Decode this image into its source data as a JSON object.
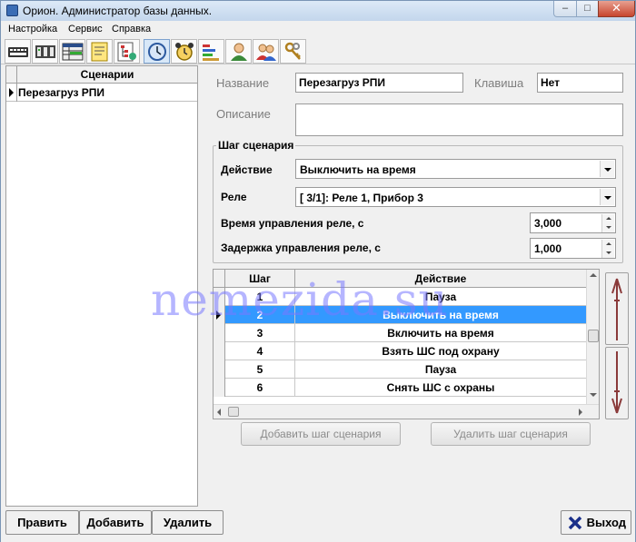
{
  "window": {
    "title": "Орион. Администратор базы данных.",
    "controls": {
      "minimize": "–",
      "maximize": "□",
      "close": "✕"
    }
  },
  "menu": [
    {
      "label": "Настройка"
    },
    {
      "label": "Сервис"
    },
    {
      "label": "Справка"
    }
  ],
  "toolbar": [
    {
      "icon": "keyboard-icon"
    },
    {
      "icon": "devices-icon"
    },
    {
      "icon": "database-table-icon"
    },
    {
      "icon": "notes-icon"
    },
    {
      "icon": "tree-icon"
    },
    {
      "icon": "clock-icon"
    },
    {
      "icon": "alarm-clock-icon"
    },
    {
      "icon": "chart-icon"
    },
    {
      "icon": "user-icon"
    },
    {
      "icon": "users-icon"
    },
    {
      "icon": "keys-icon"
    }
  ],
  "scenarios": {
    "header": "Сценарии",
    "items": [
      {
        "name": "Перезагруз РПИ"
      }
    ]
  },
  "details": {
    "name_label": "Название",
    "name_value": "Перезагруз РПИ",
    "key_label": "Клавиша",
    "key_value": "Нет",
    "description_label": "Описание",
    "description_value": ""
  },
  "step": {
    "group_title": "Шаг сценария",
    "action_label": "Действие",
    "action_value": "Выключить на время",
    "relay_label": "Реле",
    "relay_value": "[ 3/1]: Реле 1, Прибор 3",
    "time_label": "Время управления реле,  с",
    "time_value": "3,000",
    "delay_label": "Задержка управления реле,  с",
    "delay_value": "1,000"
  },
  "steps_table": {
    "columns": [
      "Шаг",
      "Действие"
    ],
    "rows": [
      {
        "step": "1",
        "action": "Пауза"
      },
      {
        "step": "2",
        "action": "Выключить на время"
      },
      {
        "step": "3",
        "action": "Включить на время"
      },
      {
        "step": "4",
        "action": "Взять ШС под охрану"
      },
      {
        "step": "5",
        "action": "Пауза"
      },
      {
        "step": "6",
        "action": "Снять ШС с охраны"
      }
    ],
    "selected_index": 1,
    "colors": {
      "selection": "#3399ff"
    }
  },
  "step_buttons": {
    "add": "Добавить шаг сценария",
    "remove": "Удалить шаг сценария"
  },
  "bottom": {
    "edit": "Править",
    "add": "Добавить",
    "delete": "Удалить",
    "exit": "Выход"
  },
  "watermark": "nemezida.su"
}
